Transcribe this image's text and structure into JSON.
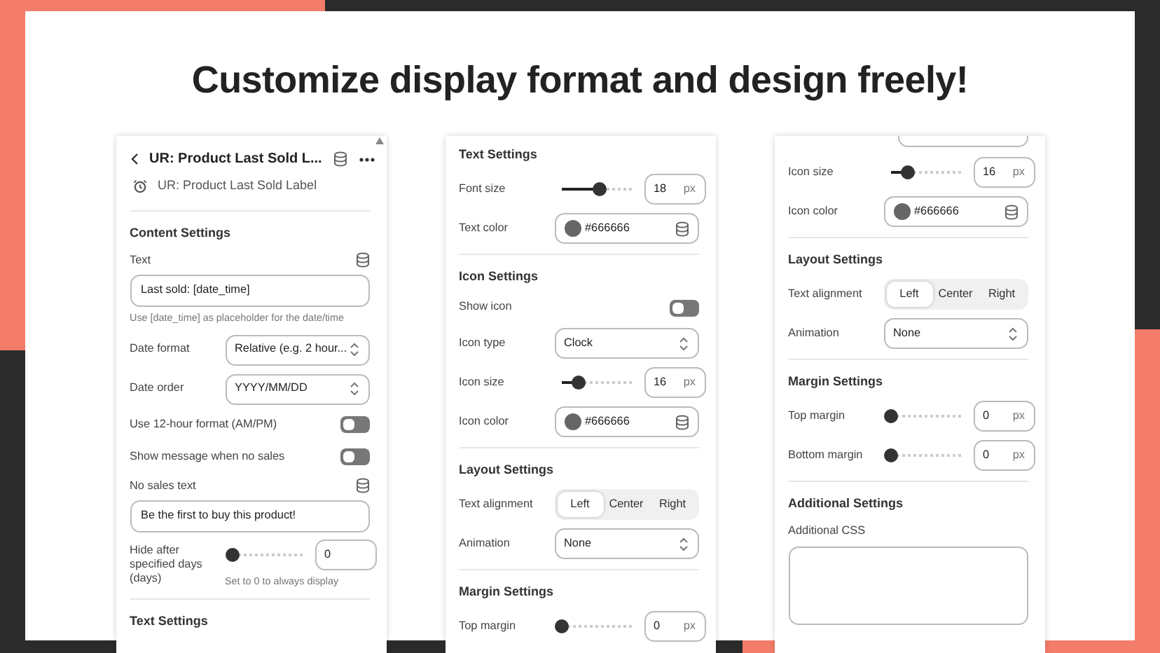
{
  "headline": "Customize display format and design freely!",
  "panels": [
    {
      "scrollbar": true,
      "rows": [
        {
          "kind": "header",
          "title": "UR: Product Last Sold L...",
          "subtitle": "UR: Product Last Sold Label"
        },
        {
          "kind": "divider"
        },
        {
          "kind": "section",
          "title": "Content Settings"
        },
        {
          "kind": "text-input",
          "label": "Text",
          "value": "Last sold: [date_time]",
          "hint": "Use [date_time] as placeholder for the date/time"
        },
        {
          "kind": "select",
          "label": "Date format",
          "value": "Relative (e.g. 2 hour..."
        },
        {
          "kind": "select",
          "label": "Date order",
          "value": "YYYY/MM/DD"
        },
        {
          "kind": "toggle",
          "label": "Use 12-hour format (AM/PM)",
          "on": false
        },
        {
          "kind": "toggle",
          "label": "Show message when no sales",
          "on": false
        },
        {
          "kind": "text-input",
          "label": "No sales text",
          "value": "Be the first to buy this product!"
        },
        {
          "kind": "slider",
          "label": "Hide after specified days (days)",
          "level": 0,
          "value": "0",
          "hint": "Set to 0 to always display"
        },
        {
          "kind": "divider"
        },
        {
          "kind": "section",
          "title": "Text Settings"
        }
      ]
    },
    {
      "scrollbar": false,
      "rows": [
        {
          "kind": "section",
          "title": "Text Settings"
        },
        {
          "kind": "slider",
          "label": "Font size",
          "level": 0.55,
          "value": "18",
          "unit": "px"
        },
        {
          "kind": "color",
          "label": "Text color",
          "value": "#666666",
          "color": "#666666"
        },
        {
          "kind": "divider"
        },
        {
          "kind": "section",
          "title": "Icon Settings"
        },
        {
          "kind": "toggle",
          "label": "Show icon",
          "on": false
        },
        {
          "kind": "select",
          "label": "Icon type",
          "value": "Clock"
        },
        {
          "kind": "slider",
          "label": "Icon size",
          "level": 0.25,
          "value": "16",
          "unit": "px"
        },
        {
          "kind": "color",
          "label": "Icon color",
          "value": "#666666",
          "color": "#666666"
        },
        {
          "kind": "divider"
        },
        {
          "kind": "section",
          "title": "Layout Settings"
        },
        {
          "kind": "segmented",
          "label": "Text alignment",
          "options": [
            {
              "label": "Left",
              "selected": true
            },
            {
              "label": "Center",
              "selected": false
            },
            {
              "label": "Right",
              "selected": false
            }
          ]
        },
        {
          "kind": "select",
          "label": "Animation",
          "value": "None"
        },
        {
          "kind": "divider"
        },
        {
          "kind": "section",
          "title": "Margin Settings"
        },
        {
          "kind": "slider",
          "label": "Top margin",
          "level": 0,
          "value": "0",
          "unit": "px"
        }
      ]
    },
    {
      "scrollbar": false,
      "rows": [
        {
          "kind": "cut-field"
        },
        {
          "kind": "slider",
          "label": "Icon size",
          "level": 0.25,
          "value": "16",
          "unit": "px"
        },
        {
          "kind": "color",
          "label": "Icon color",
          "value": "#666666",
          "color": "#666666"
        },
        {
          "kind": "divider"
        },
        {
          "kind": "section",
          "title": "Layout Settings"
        },
        {
          "kind": "segmented",
          "label": "Text alignment",
          "options": [
            {
              "label": "Left",
              "selected": true
            },
            {
              "label": "Center",
              "selected": false
            },
            {
              "label": "Right",
              "selected": false
            }
          ]
        },
        {
          "kind": "select",
          "label": "Animation",
          "value": "None"
        },
        {
          "kind": "divider"
        },
        {
          "kind": "section",
          "title": "Margin Settings"
        },
        {
          "kind": "slider",
          "label": "Top margin",
          "level": 0,
          "value": "0",
          "unit": "px"
        },
        {
          "kind": "slider",
          "label": "Bottom margin",
          "level": 0,
          "value": "0",
          "unit": "px"
        },
        {
          "kind": "divider"
        },
        {
          "kind": "section",
          "title": "Additional Settings"
        },
        {
          "kind": "textarea",
          "label": "Additional CSS"
        }
      ]
    }
  ]
}
